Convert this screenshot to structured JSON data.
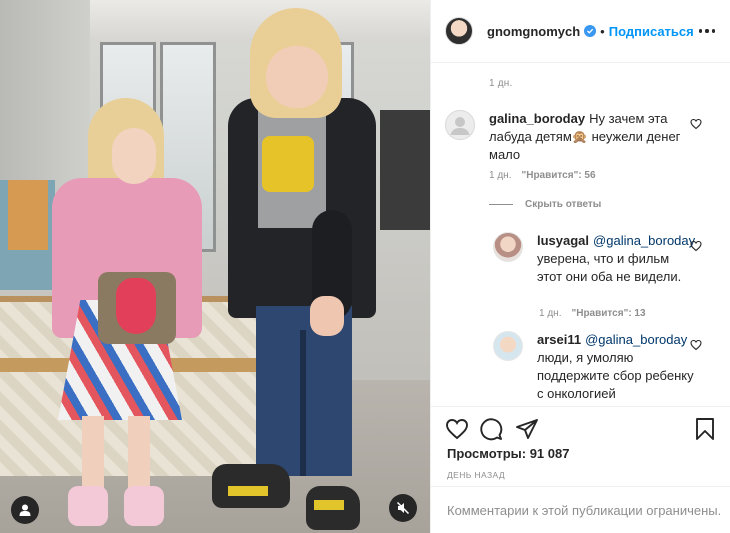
{
  "post": {
    "author": "gnomgnomych",
    "verified": true,
    "separator": "•",
    "follow_label": "Подписаться",
    "caption_time": "1 дн."
  },
  "comments": [
    {
      "username": "galina_boroday",
      "text": "Ну зачем эта лабуда детям🙊 неужели денег мало",
      "time": "1 дн.",
      "likes_label": "\"Нравится\": 56",
      "avatar_color": "#dbdbdb"
    }
  ],
  "hide_replies_label": "Скрыть ответы",
  "replies": [
    {
      "username": "lusyagal",
      "mention": "@galina_boroday",
      "text": "уверена, что и фильм этот они оба не видели.",
      "time": "1 дн.",
      "likes_label": "\"Нравится\": 13",
      "avatar_color": "#c9a7a0"
    },
    {
      "username": "arsei11",
      "mention": "@galina_boroday",
      "text": "люди, я умоляю поддержите сбор ребенку с онкологией",
      "avatar_color": "#e9c9b3"
    }
  ],
  "stats": {
    "views_label": "Просмотры: 91 087",
    "date_label": "ДЕНЬ НАЗАД"
  },
  "comments_limited": "Комментарии к этой публикации ограничены.",
  "icons": [
    "user-tag-icon",
    "mute-icon",
    "verified-icon",
    "more-icon",
    "heart-icon",
    "comment-icon",
    "share-icon",
    "bookmark-icon"
  ],
  "colors": {
    "link": "#0095f6",
    "mention": "#00376b",
    "muted": "#8e8e8e",
    "text": "#262626"
  }
}
